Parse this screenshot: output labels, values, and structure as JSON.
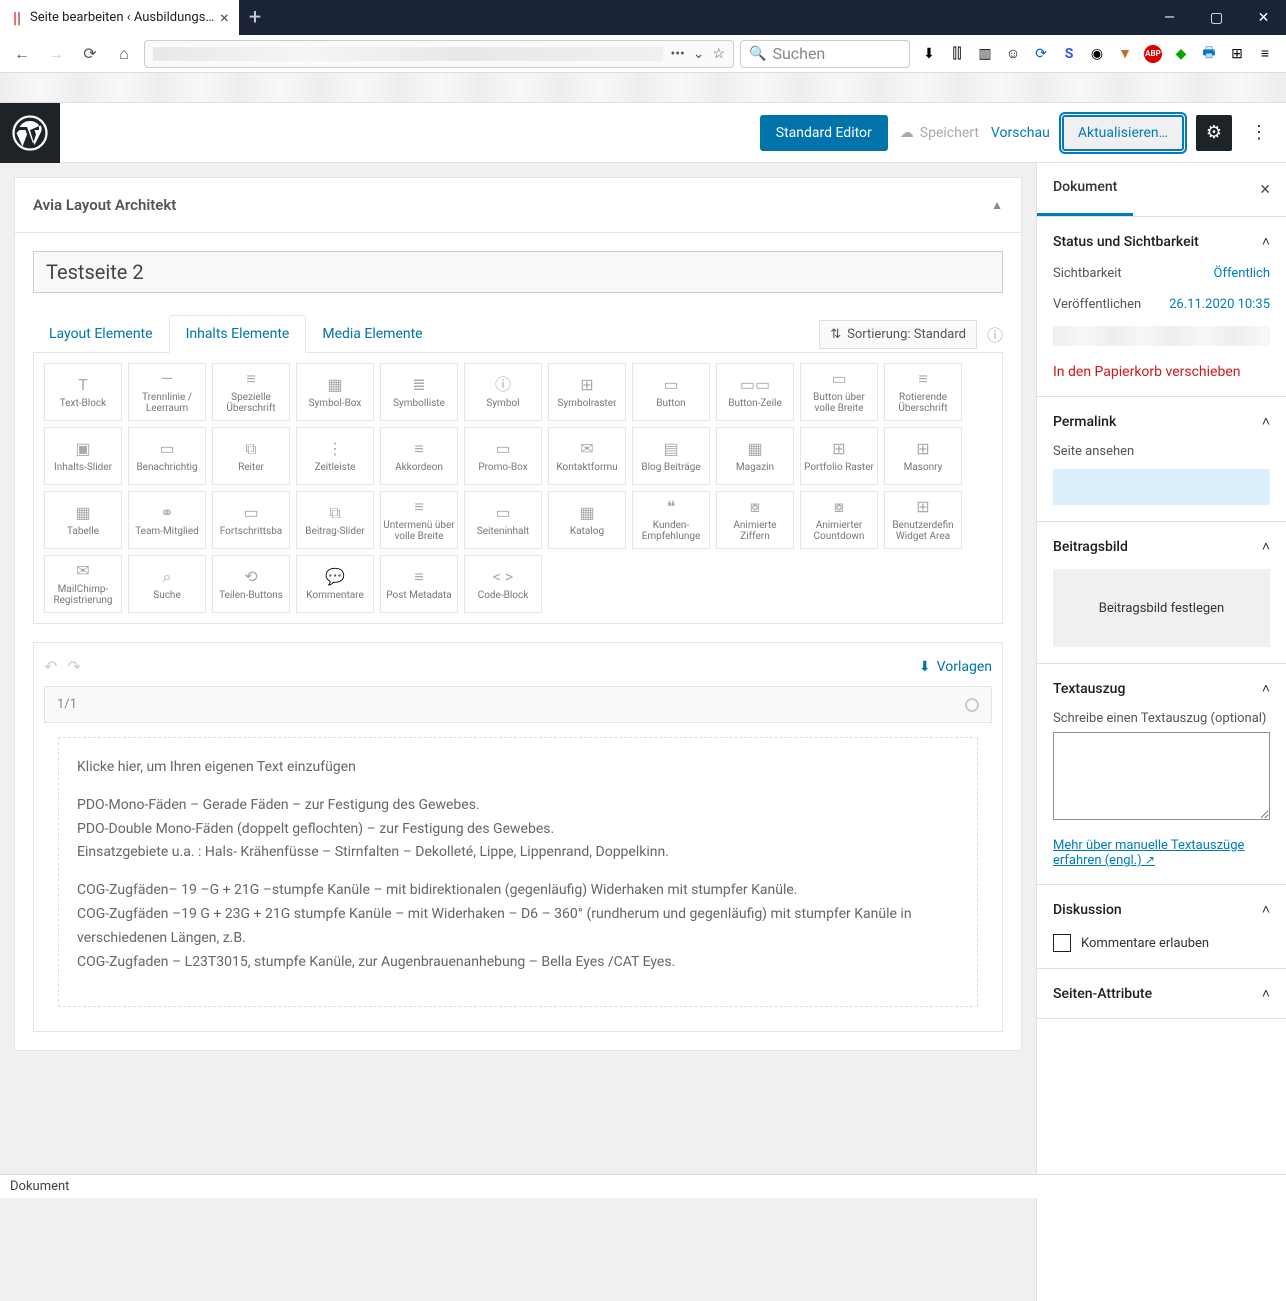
{
  "browser": {
    "tab_title": "Seite bearbeiten ‹ Ausbildungs…",
    "search_placeholder": "Suchen",
    "win": {
      "min": "—",
      "max": "▢",
      "close": "✕"
    }
  },
  "editor_top": {
    "standard": "Standard Editor",
    "saving": "Speichert",
    "preview": "Vorschau",
    "update": "Aktualisieren…"
  },
  "avia": {
    "panel_title": "Avia Layout Architekt",
    "page_title": "Testseite 2",
    "tabs": {
      "layout": "Layout Elemente",
      "content": "Inhalts Elemente",
      "media": "Media Elemente"
    },
    "sort": "Sortierung: Standard",
    "section_label": "1/1",
    "vorlagen": "Vorlagen",
    "elements": [
      "Text-Block",
      "Trennlinie / Leerraum",
      "Spezielle Überschrift",
      "Symbol-Box",
      "Symbolliste",
      "Symbol",
      "Symbolraster",
      "Button",
      "Button-Zeile",
      "Button über volle Breite",
      "Rotierende Überschrift",
      "Inhalts-Slider",
      "Benachrichtig",
      "Reiter",
      "Zeitleiste",
      "Akkordeon",
      "Promo-Box",
      "Kontaktformu",
      "Blog Beiträge",
      "Magazin",
      "Portfolio Raster",
      "Masonry",
      "Tabelle",
      "Team-Mitglied",
      "Fortschrittsba",
      "Beitrag-Slider",
      "Untermenü über volle Breite",
      "Seiteninhalt",
      "Katalog",
      "Kunden-Empfehlunge",
      "Animierte Ziffern",
      "Animierter Countdown",
      "Benutzerdefin Widget Area",
      "MailChimp-Registrierung",
      "Suche",
      "Teilen-Buttons",
      "Kommentare",
      "Post Metadata",
      "Code-Block"
    ],
    "icons": [
      "T",
      "—",
      "≡",
      "▦",
      "≣",
      "ⓘ",
      "⊞",
      "▭",
      "▭▭",
      "▭",
      "≡",
      "▣",
      "▭",
      "⧉",
      "⋮",
      "≡",
      "▭",
      "✉",
      "▤",
      "▦",
      "⊞",
      "⊞",
      "▦",
      "⚭",
      "▭",
      "⧉",
      "≡",
      "▭",
      "▦",
      "❝",
      "⧇",
      "⧇",
      "⊞",
      "✉",
      "⌕",
      "⟲",
      "💬",
      "≡",
      "< >"
    ],
    "content_lines": [
      "Klicke hier, um Ihren eigenen Text einzufügen",
      "PDO-Mono-Fäden – Gerade Fäden – zur Festigung des Gewebes.",
      "PDO-Double Mono-Fäden (doppelt geflochten)  – zur Festigung des Gewebes.",
      "Einsatzgebiete u.a. : Hals- Krähenfüsse – Stirnfalten – Dekolleté, Lippe, Lippenrand, Doppelkinn.",
      "COG-Zugfäden– 19 –G + 21G –stumpfe Kanüle – mit bidirektionalen (gegenläufig) Widerhaken mit stumpfer Kanüle.",
      "COG-Zugfäden –19 G + 23G + 21G stumpfe Kanüle –  mit Widerhaken – D6 – 360° (rundherum und gegenläufig) mit stumpfer Kanüle in verschiedenen Längen, z.B.",
      "COG-Zugfaden – L23T3015, stumpfe Kanüle,  zur Augenbrauenanhebung – Bella Eyes /CAT Eyes."
    ]
  },
  "sidebar": {
    "tab": "Dokument",
    "status_title": "Status und Sichtbarkeit",
    "visibility_lbl": "Sichtbarkeit",
    "visibility_val": "Öffentlich",
    "publish_lbl": "Veröffentlichen",
    "publish_val": "26.11.2020 10:35",
    "trash": "In den Papierkorb verschieben",
    "permalink_title": "Permalink",
    "permalink_view": "Seite ansehen",
    "featured_title": "Beitragsbild",
    "featured_set": "Beitragsbild festlegen",
    "excerpt_title": "Textauszug",
    "excerpt_lbl": "Schreibe einen Textauszug (optional)",
    "excerpt_link": "Mehr über manuelle Textauszüge erfahren (engl.)",
    "discussion_title": "Diskussion",
    "discussion_allow": "Kommentare erlauben",
    "attrs_title": "Seiten-Attribute"
  },
  "status": "Dokument"
}
